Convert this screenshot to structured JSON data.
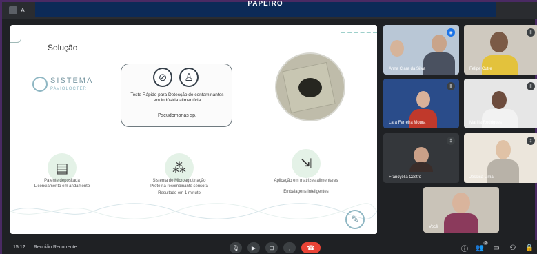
{
  "meeting": {
    "banner": "PAPEIRO",
    "topbar_letter": "A",
    "time": "15:12",
    "meeting_name": "Reunião Recorrente"
  },
  "slide": {
    "title": "Solução",
    "logo_main": "SISTEMA",
    "logo_sub": "PAVIOLOCTER",
    "card_text": "Teste Rápido para Detecção de contaminantes em indústria alimentícia",
    "card_subtext": "Pseudomonas sp.",
    "features": [
      {
        "icon": "document-icon",
        "glyph": "▤",
        "lines": [
          "Patente depositada",
          "Licenciamento em andamento"
        ]
      },
      {
        "icon": "network-icon",
        "glyph": "⁂",
        "lines": [
          "Sistema de Microaglutinação",
          "Proteína recombinante sensora",
          "Resultado em 1 minuto"
        ]
      },
      {
        "icon": "application-icon",
        "glyph": "⇲",
        "lines": [
          "Aplicação em matrizes alimentares",
          "Embalagens inteligentes"
        ]
      }
    ]
  },
  "participants": [
    {
      "name": "Anna Clara da Silva",
      "active": true,
      "bg": "#b9c7d6",
      "skin": "#d6b49a",
      "shirt": "#4a5160"
    },
    {
      "name": "Felipe Cutre",
      "active": false,
      "bg": "#cfc9bf",
      "skin": "#7b5a46",
      "shirt": "#e3c23c"
    },
    {
      "name": "Lara Ferreira Moura",
      "active": false,
      "bg": "#2a4c8a",
      "skin": "#d8b19a",
      "shirt": "#c0392b"
    },
    {
      "name": "Marília Rodrigues",
      "active": false,
      "bg": "#e6e6e6",
      "skin": "#6d4c3d",
      "shirt": "#f2f2f2"
    },
    {
      "name": "Francyélia Castro",
      "active": false,
      "bg": "#34373b",
      "skin": "#caa088",
      "shirt": "#3a2d2a"
    },
    {
      "name": "Jéssica Lima",
      "active": false,
      "bg": "#ece6dc",
      "skin": "#e0c2a6",
      "shirt": "#b8b2a8"
    },
    {
      "name": "Você",
      "active": false,
      "bg": "#c9c3b8",
      "skin": "#d9b49c",
      "shirt": "#8b3a5c"
    }
  ],
  "controls": {
    "mic": "🎙",
    "camera": "▶",
    "present": "⊡",
    "more": "⋮",
    "end": "☎",
    "info": "ⓘ",
    "people": "👥",
    "people_count": "8",
    "chat": "▭",
    "activities": "⚇",
    "lock": "🔒"
  }
}
